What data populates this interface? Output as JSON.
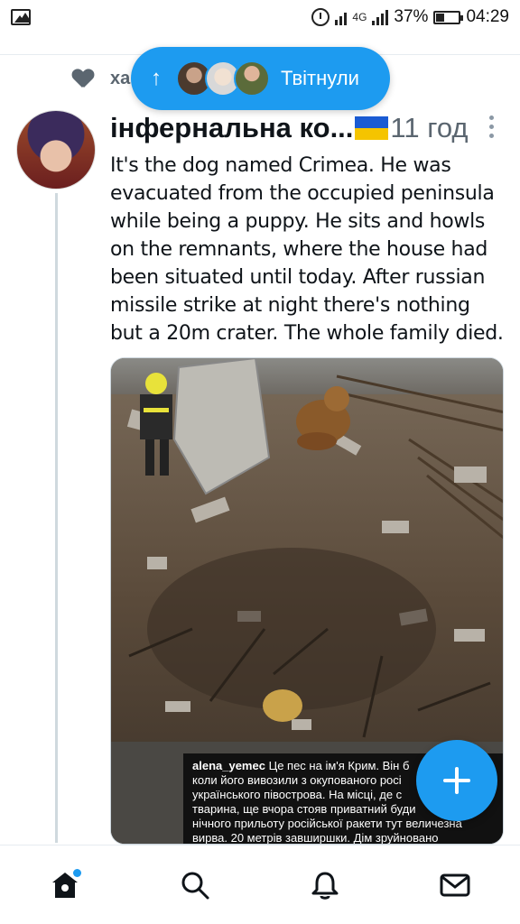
{
  "status_bar": {
    "network": "4G",
    "battery": "37%",
    "battery_level": 0.37,
    "time": "04:29"
  },
  "context": {
    "text": "ха"
  },
  "new_tweets_pill": {
    "label": "Твітнули"
  },
  "tweet": {
    "display_name": "інфернальна ко...",
    "time": "11 год",
    "text": "It's the dog named Crimea. He was evacuated from the occupied peninsula while being a puppy. He sits and howls on the remnants, where the house had been situated until today. After russian missile strike at night there's nothing but a 20m crater. The whole family died.",
    "photo": {
      "caption_user": "alena_yemec",
      "caption_lines": [
        "Це пес на ім'я Крим. Він б",
        "коли його вивозили з окупованого росі",
        "українського півострова. На місці, де с",
        "тварина, ще вчора стояв приватний буди",
        "нічного прильоту російської ракети тут величезна",
        "вирва. 20 метрів завширшки. Дім зруйновано"
      ]
    }
  },
  "colors": {
    "accent": "#1d9bf0",
    "secondary_text": "#5b6670",
    "flag_blue": "#1a5bd3",
    "flag_yellow": "#f5c400"
  },
  "bottom_nav": {
    "items": [
      "home-icon",
      "search-icon",
      "notifications-icon",
      "messages-icon"
    ]
  }
}
